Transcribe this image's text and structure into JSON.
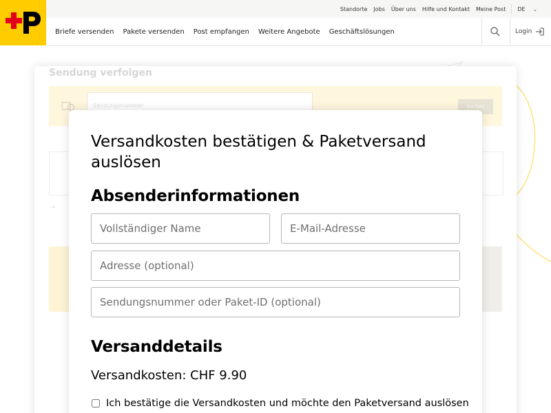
{
  "header": {
    "utility_links": [
      "Standorte",
      "Jobs",
      "Über uns",
      "Hilfe und Kontakt",
      "Meine Post"
    ],
    "language": "DE",
    "nav_items": [
      "Briefe versenden",
      "Pakete versenden",
      "Post empfangen",
      "Weitere Angebote",
      "Geschäftslösungen"
    ],
    "login_label": "Login"
  },
  "background": {
    "title": "Sendung verfolgen",
    "tracking_placeholder": "Sendungsnummer",
    "search_label": "Suchen"
  },
  "modal": {
    "title": "Versandkosten bestätigen & Paketversand auslösen",
    "sender_heading": "Absenderinformationen",
    "fields": {
      "name_placeholder": "Vollständiger Name",
      "email_placeholder": "E-Mail-Adresse",
      "address_placeholder": "Adresse (optional)",
      "tracking_placeholder": "Sendungsnummer oder Paket-ID (optional)"
    },
    "shipping_heading": "Versanddetails",
    "shipping_costs": "Versandkosten: CHF 9.90",
    "confirm_label": "Ich bestätige die Versandkosten und möchte den Paketversand auslösen"
  },
  "colors": {
    "brand_yellow": "#ffcc00",
    "logo_red": "#e2001a"
  }
}
